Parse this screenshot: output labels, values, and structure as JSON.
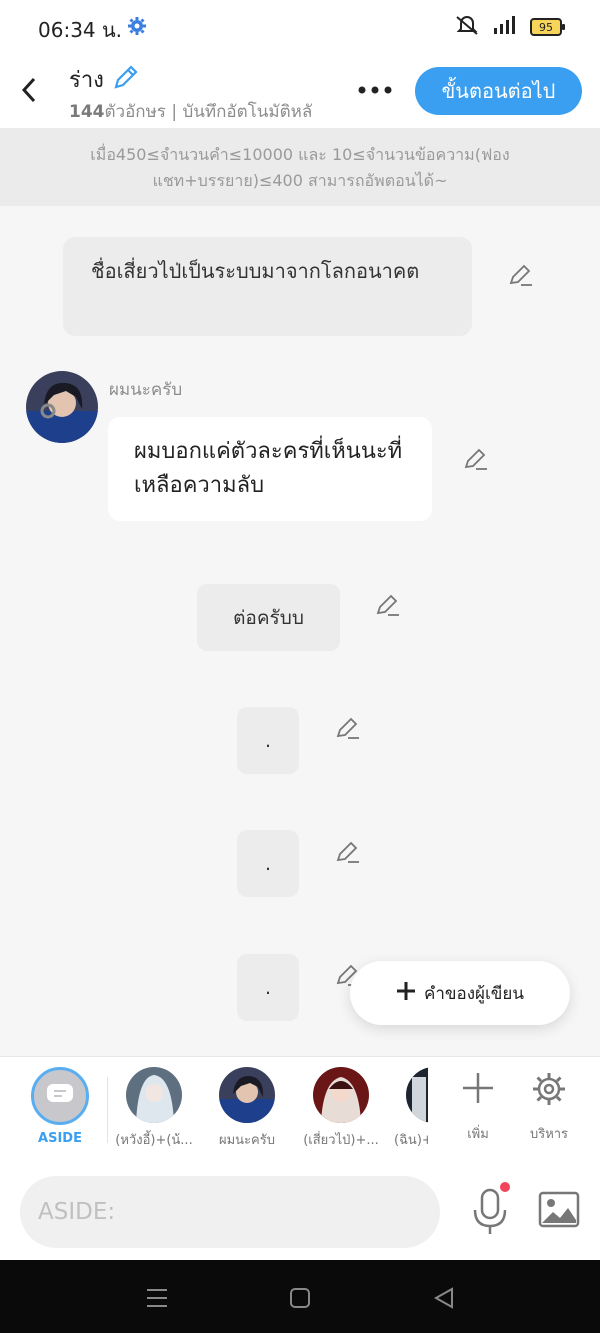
{
  "status": {
    "time": "06:34 น.",
    "battery": "95"
  },
  "header": {
    "title": "ร่าง",
    "word_count": "144",
    "subtitle_rest": "ตัวอักษร | บันทึกอัตโนมัติหลั",
    "next_label": "ขั้นตอนต่อไป"
  },
  "notice": {
    "text": "เมื่อ450≤จำนวนคำ≤10000 และ 10≤จำนวนข้อความ(ฟองแชท+บรรยาย)≤400 สามารถอัพตอนได้~"
  },
  "messages": {
    "narration": "ชื่อเสี่ยวไป่เป็นระบบมาจากโลกอนาคต",
    "character_name": "ผมนะครับ",
    "character_text": "ผมบอกแค่ตัวละครที่เห็นนะที่เหลือความลับ",
    "small_1": "ต่อครับบ",
    "dot_1": ".",
    "dot_2": ".",
    "dot_3": "."
  },
  "author_button": {
    "label": "คำของผู้เขียน"
  },
  "characters": [
    {
      "label": "ASIDE"
    },
    {
      "label": "(หวังอี้)+(น้..."
    },
    {
      "label": "ผมนะครับ"
    },
    {
      "label": "(เสี่ยวไป่)+..."
    },
    {
      "label": "(ฉิน)+"
    }
  ],
  "actions": {
    "add_label": "เพิ่ม",
    "manage_label": "บริหาร"
  },
  "input": {
    "placeholder": "ASIDE:"
  },
  "colors": {
    "accent": "#3a9ff0",
    "aside_border": "#59aef2",
    "mic_dot": "#f2445a"
  }
}
